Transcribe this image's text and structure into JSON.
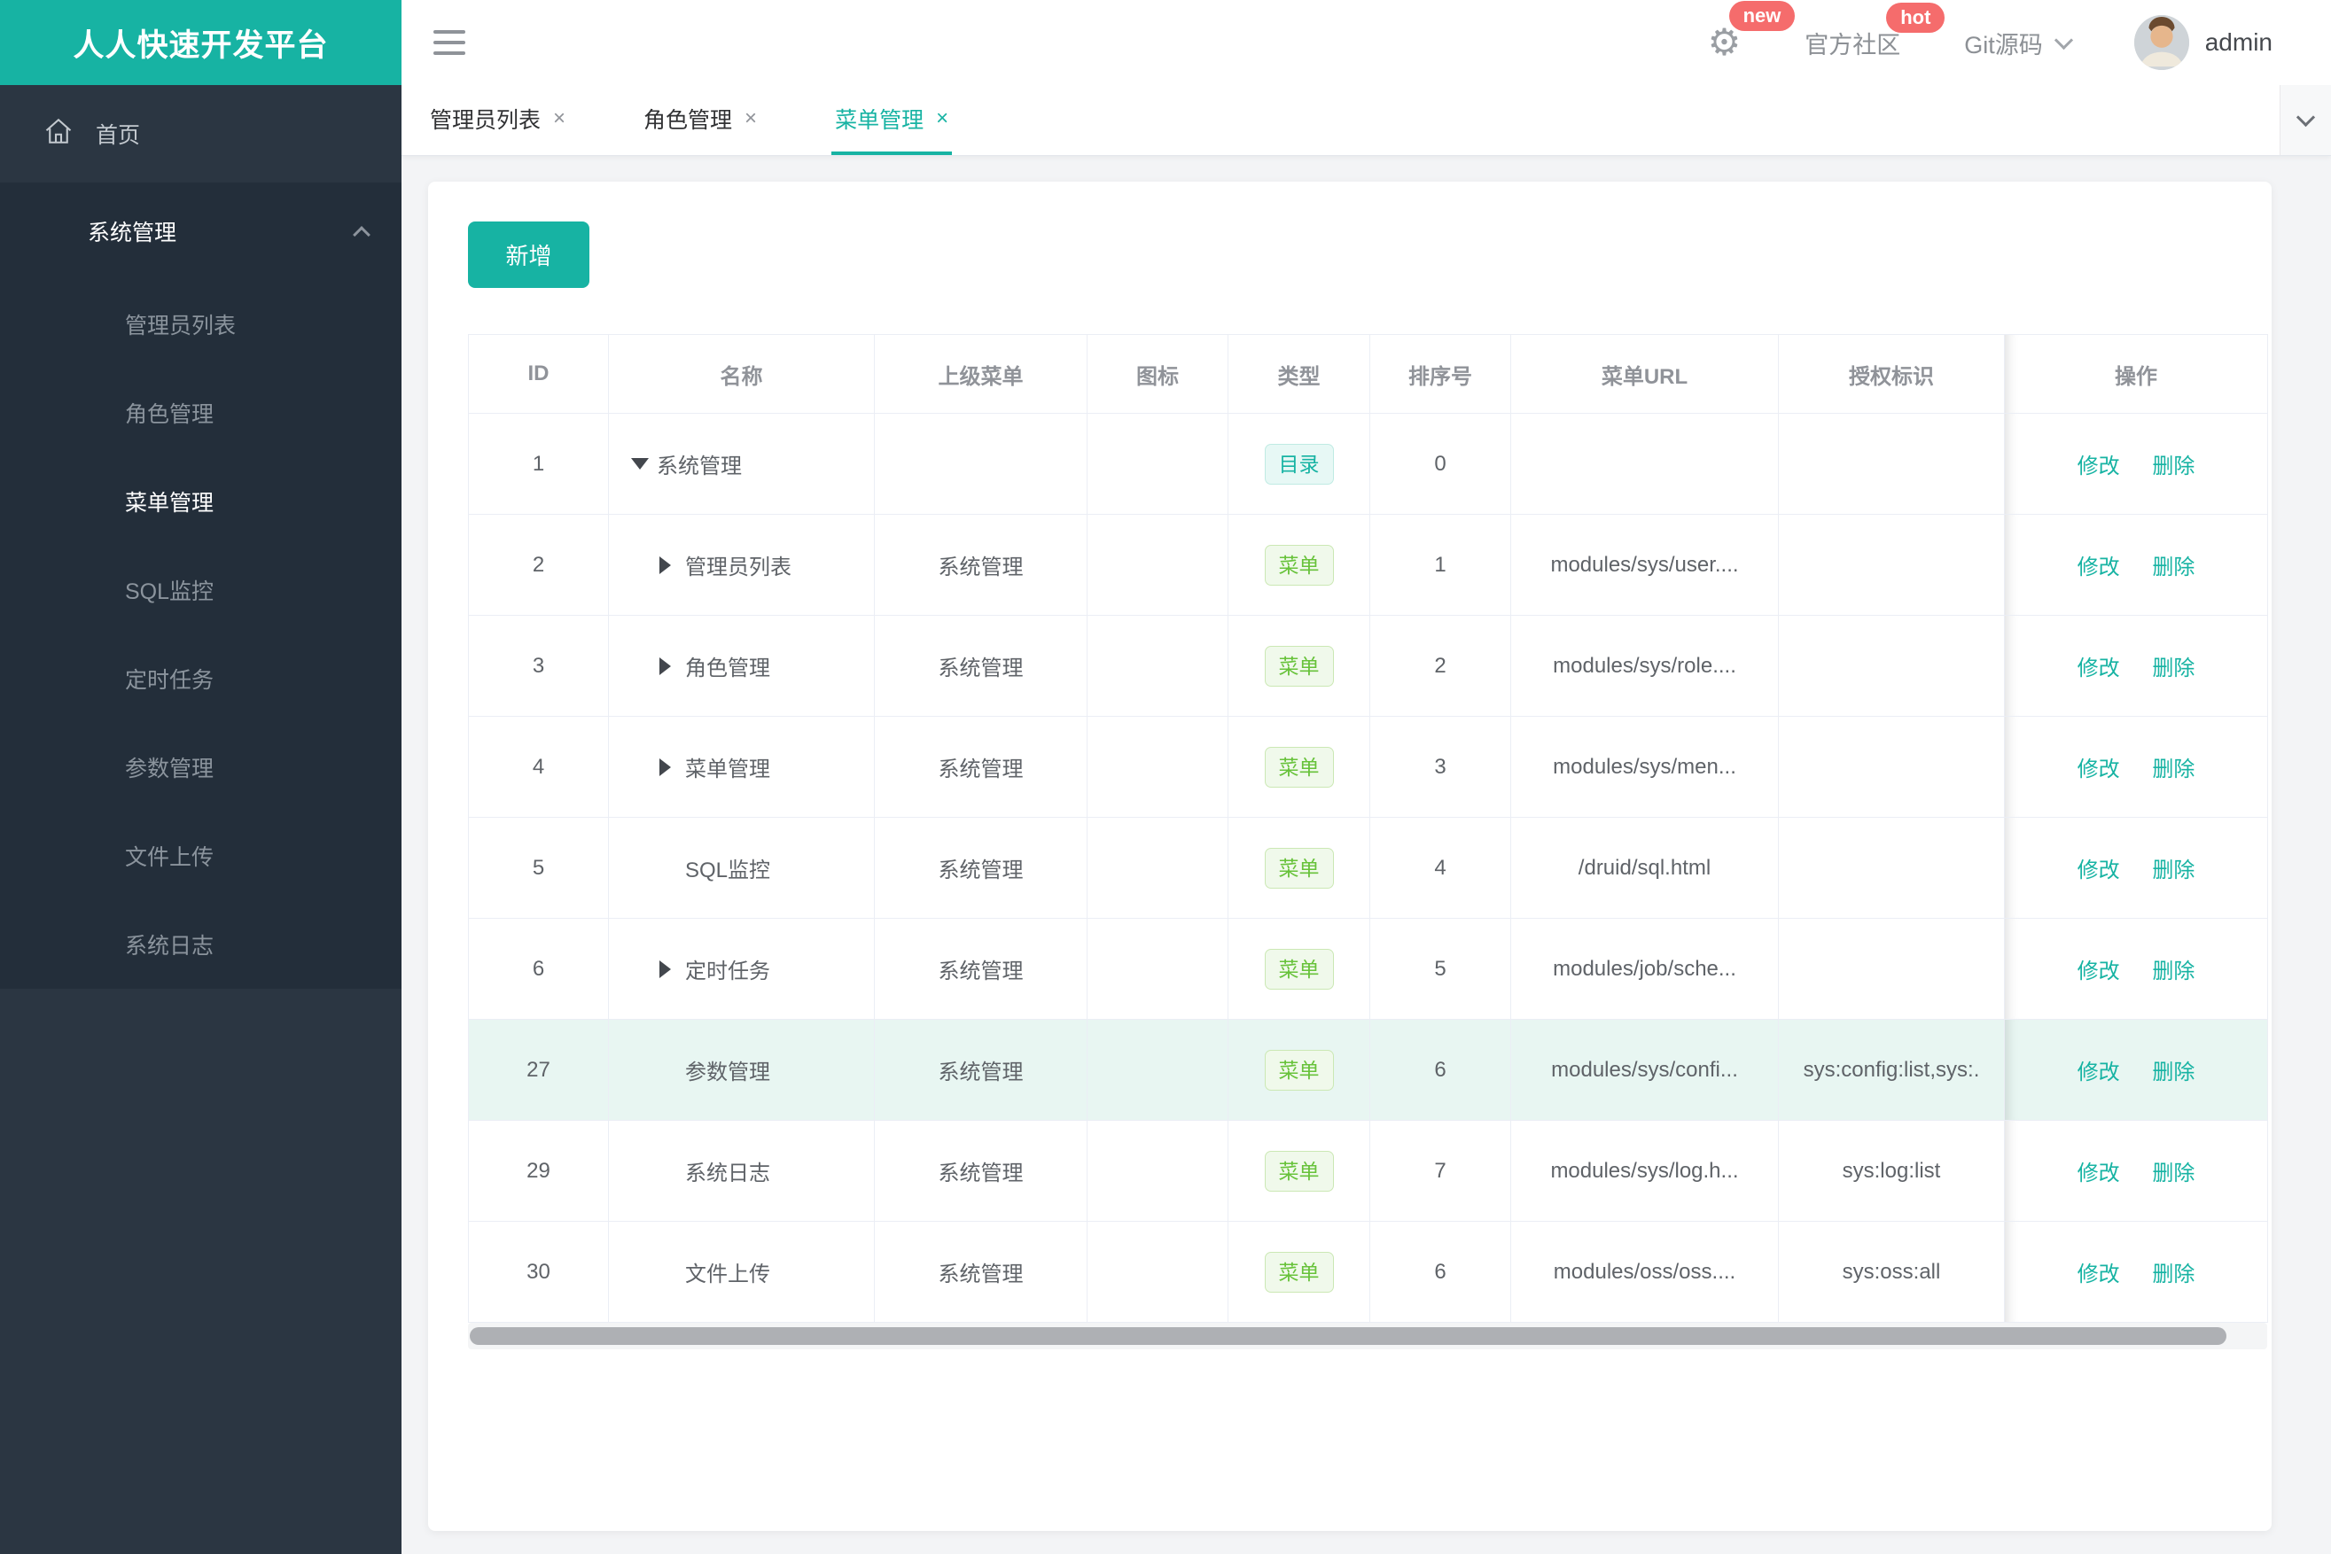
{
  "colors": {
    "accent": "#17b3a3",
    "badge_red": "#f56c6c",
    "tag_menu_green": "#67c23a",
    "sidebar_bg": "#2b3642",
    "sidebar_submenu_bg": "#232e3a",
    "highlight_row_bg": "#e8f6f2"
  },
  "icons": {
    "gear": "⚙",
    "close": "×"
  },
  "header": {
    "logo": "人人快速开发平台",
    "badge_new": "new",
    "badge_hot": "hot",
    "community_label": "官方社区",
    "git_label": "Git源码",
    "user_name": "admin"
  },
  "sidebar": {
    "home_label": "首页",
    "group_label": "系统管理",
    "children": [
      "管理员列表",
      "角色管理",
      "菜单管理",
      "SQL监控",
      "定时任务",
      "参数管理",
      "文件上传",
      "系统日志"
    ]
  },
  "tabs": [
    {
      "label": "管理员列表"
    },
    {
      "label": "角色管理"
    },
    {
      "label": "菜单管理"
    }
  ],
  "toolbar": {
    "add_label": "新增"
  },
  "table": {
    "columns": [
      "ID",
      "名称",
      "上级菜单",
      "图标",
      "类型",
      "排序号",
      "菜单URL",
      "授权标识",
      "操作"
    ],
    "actions": {
      "edit": "修改",
      "delete": "删除"
    },
    "rows": [
      {
        "id": "1",
        "name": "系统管理",
        "parent": "",
        "icon": "",
        "type_label": "目录",
        "order": "0",
        "url": "",
        "perms": ""
      },
      {
        "id": "2",
        "name": "管理员列表",
        "parent": "系统管理",
        "icon": "",
        "type_label": "菜单",
        "order": "1",
        "url": "modules/sys/user....",
        "perms": ""
      },
      {
        "id": "3",
        "name": "角色管理",
        "parent": "系统管理",
        "icon": "",
        "type_label": "菜单",
        "order": "2",
        "url": "modules/sys/role....",
        "perms": ""
      },
      {
        "id": "4",
        "name": "菜单管理",
        "parent": "系统管理",
        "icon": "",
        "type_label": "菜单",
        "order": "3",
        "url": "modules/sys/men...",
        "perms": ""
      },
      {
        "id": "5",
        "name": "SQL监控",
        "parent": "系统管理",
        "icon": "",
        "type_label": "菜单",
        "order": "4",
        "url": "/druid/sql.html",
        "perms": ""
      },
      {
        "id": "6",
        "name": "定时任务",
        "parent": "系统管理",
        "icon": "",
        "type_label": "菜单",
        "order": "5",
        "url": "modules/job/sche...",
        "perms": ""
      },
      {
        "id": "27",
        "name": "参数管理",
        "parent": "系统管理",
        "icon": "",
        "type_label": "菜单",
        "order": "6",
        "url": "modules/sys/confi...",
        "perms": "sys:config:list,sys:."
      },
      {
        "id": "29",
        "name": "系统日志",
        "parent": "系统管理",
        "icon": "",
        "type_label": "菜单",
        "order": "7",
        "url": "modules/sys/log.h...",
        "perms": "sys:log:list"
      },
      {
        "id": "30",
        "name": "文件上传",
        "parent": "系统管理",
        "icon": "",
        "type_label": "菜单",
        "order": "6",
        "url": "modules/oss/oss....",
        "perms": "sys:oss:all"
      }
    ]
  }
}
